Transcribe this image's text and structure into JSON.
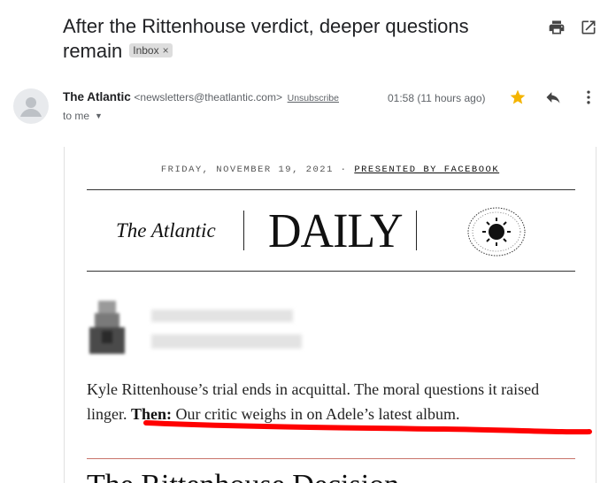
{
  "email": {
    "subject": "After the Rittenhouse verdict, deeper questions remain",
    "label": "Inbox",
    "label_remove_symbol": "×",
    "sender_name": "The Atlantic",
    "sender_email": "<newsletters@theatlantic.com>",
    "unsubscribe_label": "Unsubscribe",
    "recipient_label": "to me",
    "timestamp": "01:58 (11 hours ago)"
  },
  "icons": {
    "print": "printer-icon",
    "open_new_window": "open-in-new-window-icon",
    "star": "star-icon",
    "reply": "reply-icon",
    "more": "more-vertical-icon",
    "avatar": "person-avatar-icon",
    "dropdown": "caret-down-icon"
  },
  "newsletter": {
    "dateline": "FRIDAY, NOVEMBER 19, 2021 ·",
    "presented_by": "PRESENTED BY FACEBOOK",
    "brand": "The Atlantic",
    "title": "DAILY",
    "lead_text": "Kyle Rittenhouse’s trial ends in acquittal. The moral questions it raised linger.",
    "then_label": "Then:",
    "then_text": "Our critic weighs in on Adele’s latest album.",
    "next_heading": "The Rittenhouse Decision"
  },
  "colors": {
    "star": "#f4b400",
    "highlight_underline": "#ff0000",
    "divider_red": "#c9746a"
  }
}
